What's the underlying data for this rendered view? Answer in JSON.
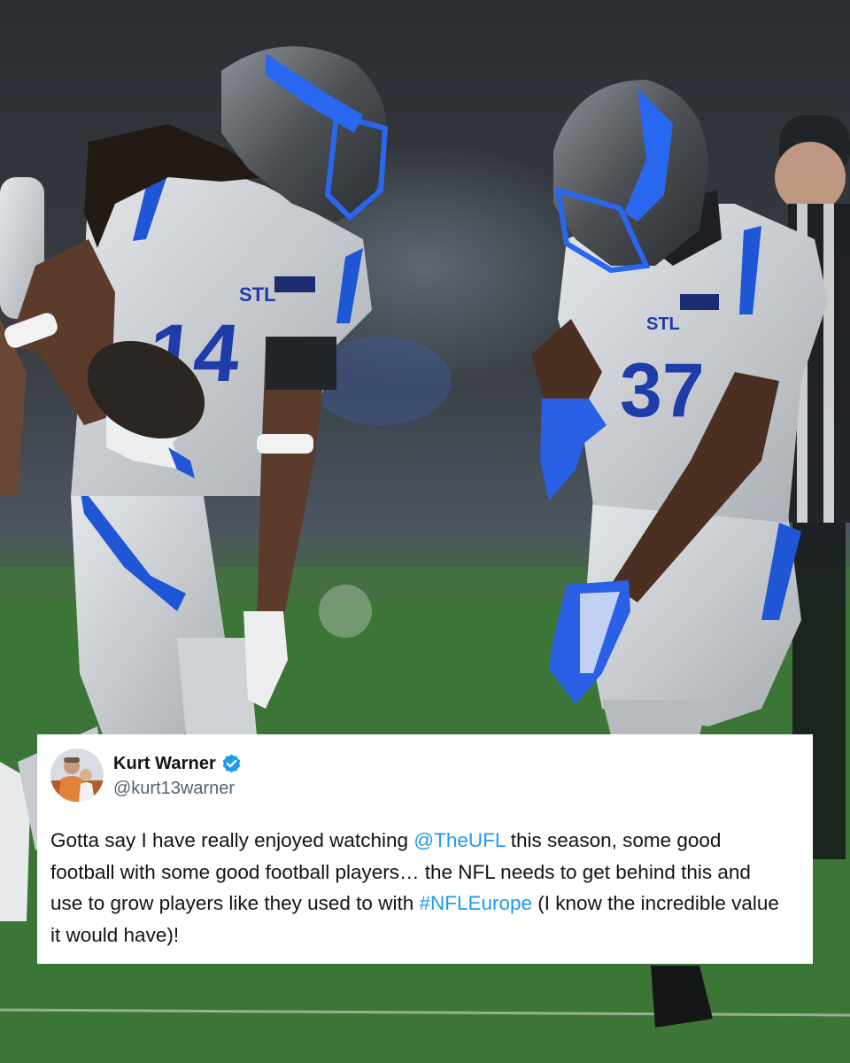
{
  "photo": {
    "subject": "two-football-players-celebrating",
    "colors": {
      "field": "#3f7a3a",
      "jersey": "#c9cdd2",
      "accent": "#1f56d6",
      "helmet": "#55595e"
    }
  },
  "tweet": {
    "author_name": "Kurt Warner",
    "verified_icon": "verified-badge-icon",
    "handle": "@kurt13warner",
    "text_parts": {
      "p1": "Gotta say I have really enjoyed watching ",
      "mention": "@TheUFL",
      "p2": " this season, some good football with some good football players… the NFL needs to get behind this and use to grow players like they used to with ",
      "hashtag": "#NFLEurope",
      "p3": " (I know the incredible value it would have)!"
    },
    "colors": {
      "link": "#1d9bf0",
      "text": "#0f1419",
      "handle": "#536471",
      "verified": "#1d9bf0"
    }
  }
}
